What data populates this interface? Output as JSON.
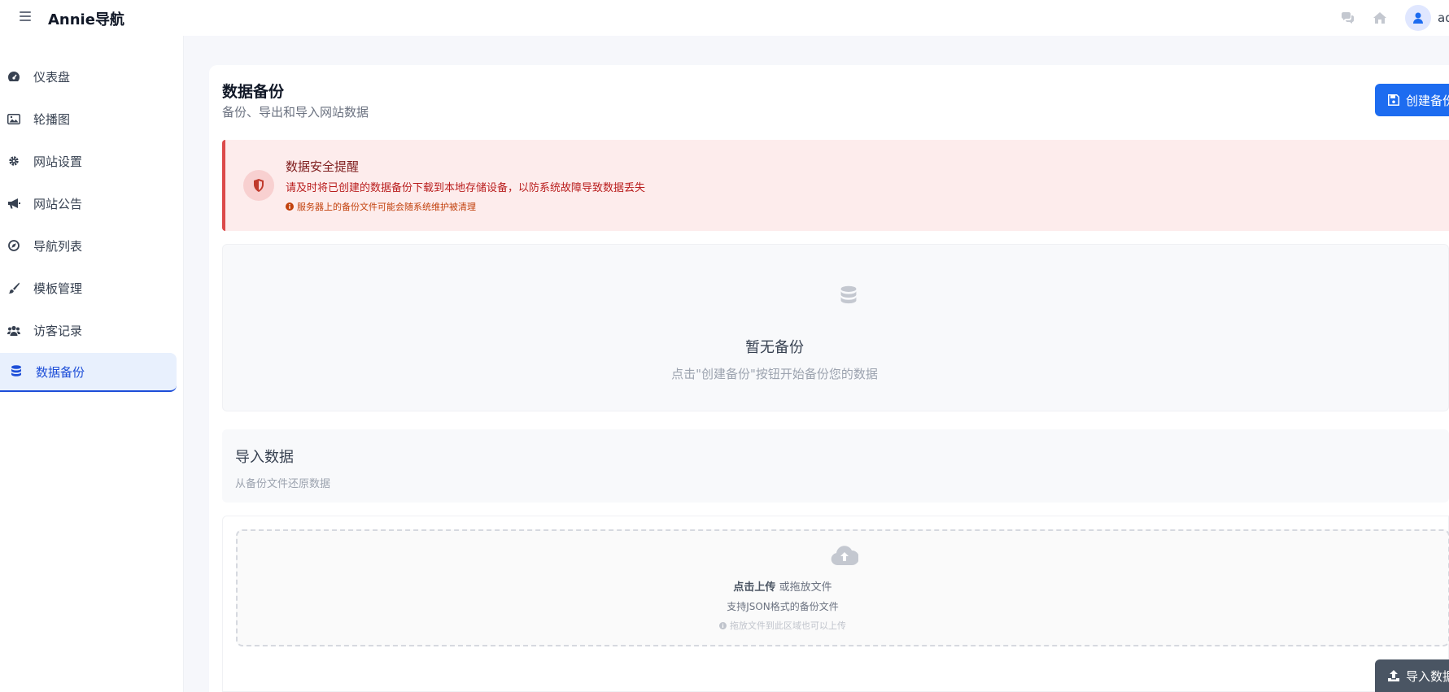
{
  "header": {
    "brand": "Annie导航",
    "user_name": "admin"
  },
  "sidebar": {
    "items": [
      {
        "label": "仪表盘",
        "icon": "dashboard-icon"
      },
      {
        "label": "轮播图",
        "icon": "image-icon"
      },
      {
        "label": "网站设置",
        "icon": "gear-icon"
      },
      {
        "label": "网站公告",
        "icon": "megaphone-icon"
      },
      {
        "label": "导航列表",
        "icon": "compass-icon"
      },
      {
        "label": "模板管理",
        "icon": "brush-icon"
      },
      {
        "label": "访客记录",
        "icon": "users-icon"
      },
      {
        "label": "数据备份",
        "icon": "database-icon",
        "active": true
      }
    ]
  },
  "main": {
    "title": "数据备份",
    "subtitle": "备份、导出和导入网站数据",
    "create_button": "创建备份",
    "alert": {
      "title": "数据安全提醒",
      "text": "请及时将已创建的数据备份下载到本地存储设备，以防系统故障导致数据丢失",
      "note": "服务器上的备份文件可能会随系统维护被清理"
    },
    "empty": {
      "title": "暂无备份",
      "subtitle": "点击\"创建备份\"按钮开始备份您的数据"
    },
    "import": {
      "title": "导入数据",
      "subtitle": "从备份文件还原数据",
      "drop_click": "点击上传",
      "drop_or": " 或拖放文件",
      "drop_sub": "支持JSON格式的备份文件",
      "drop_hint": "拖放文件到此区域也可以上传",
      "button": "导入数据"
    }
  },
  "colors": {
    "primary": "#1d6cf0",
    "danger": "#dc4a4a",
    "active_bg": "#e8f0fd"
  }
}
